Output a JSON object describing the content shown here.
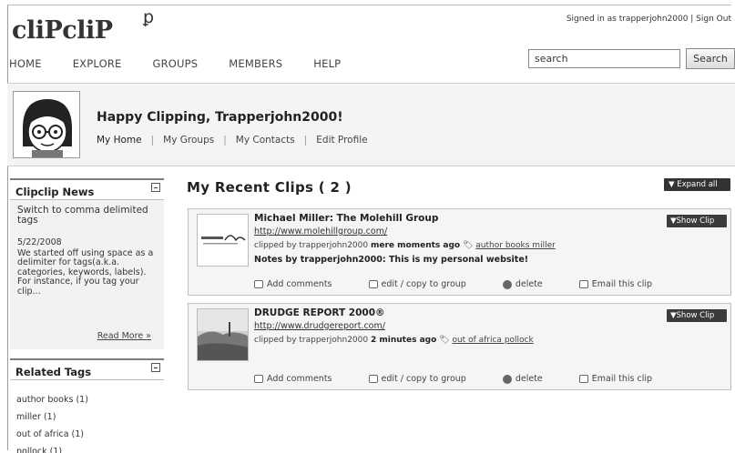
{
  "header": {
    "logo_text": "cliPcliP",
    "logo_symbol": "ꝑ",
    "signed_in_text": "Signed in as trapperjohn2000 | Sign Out"
  },
  "nav": [
    "HOME",
    "EXPLORE",
    "GROUPS",
    "MEMBERS",
    "HELP"
  ],
  "search": {
    "value": "search",
    "button_label": "Search"
  },
  "profile": {
    "greeting": "Happy Clipping, Trapperjohn2000!",
    "links": [
      "My Home",
      "My Groups",
      "My Contacts",
      "Edit Profile"
    ]
  },
  "news": {
    "title": "Clipclip News",
    "headline": "Switch to comma delimited tags",
    "date": "5/22/2008",
    "body": "We started off using space as a delimiter for tags(a.k.a. categories, keywords, labels). For instance, if you tag your clip...",
    "read_more": "Read More »"
  },
  "related_tags": {
    "title": "Related Tags",
    "items": [
      "author books (1)",
      "miller (1)",
      "out of africa (1)",
      "pollock (1)"
    ]
  },
  "main": {
    "title": "My Recent Clips ( 2 )",
    "expand_label": "▼ Expand all"
  },
  "clips": [
    {
      "title": "Michael Miller: The Molehill Group",
      "url": "http://www.molehillgroup.com/",
      "clipped_by": "clipped by trapperjohn2000",
      "when": "mere moments ago",
      "tags": "author books miller",
      "notes": "Notes by trapperjohn2000: This is my personal website!",
      "show_label": "▼Show Clip"
    },
    {
      "title": "DRUDGE REPORT 2000®",
      "url": "http://www.drudgereport.com/",
      "clipped_by": "clipped by trapperjohn2000",
      "when": "2 minutes ago",
      "tags": "out of africa pollock",
      "notes": "",
      "show_label": "▼Show Clip"
    }
  ],
  "actions": {
    "add_comments": "Add comments",
    "edit": "edit / copy to group",
    "delete": "delete",
    "email": "Email this clip"
  }
}
